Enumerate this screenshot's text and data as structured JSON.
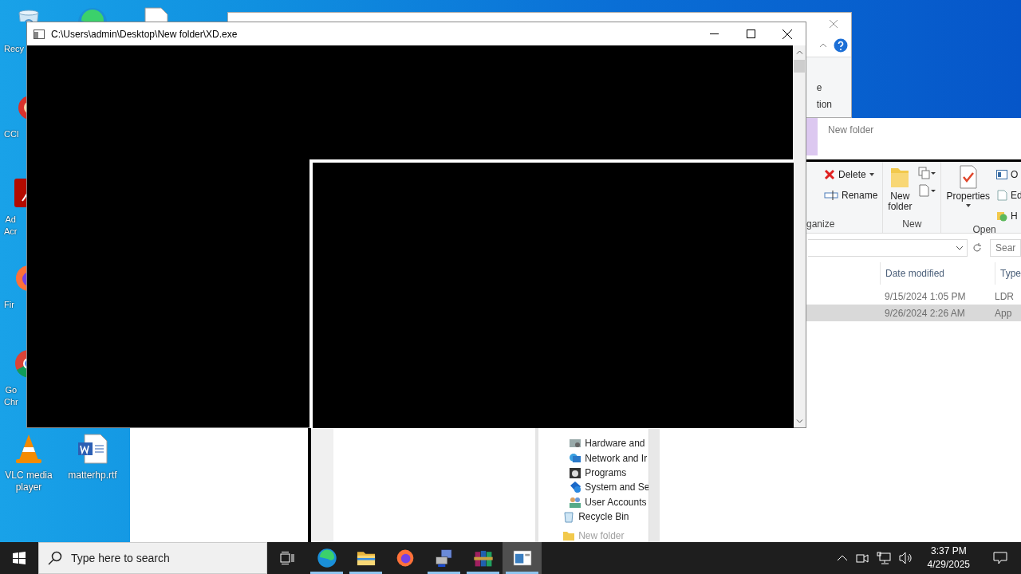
{
  "desktop": {
    "icons": [
      {
        "kind": "recycle",
        "label": "Recy"
      },
      {
        "kind": "ccleaner",
        "label": "CCl"
      },
      {
        "kind": "acrobat",
        "label": "Ad\nAcr"
      },
      {
        "kind": "firefox",
        "label": "Fir"
      },
      {
        "kind": "chrome",
        "label": "Go\nChr"
      },
      {
        "kind": "vlc",
        "label": "VLC media\nplayer"
      },
      {
        "kind": "edge"
      },
      {
        "kind": "document"
      },
      {
        "kind": "word",
        "label": "matterhp.rtf"
      }
    ]
  },
  "back_window": {
    "ribbon_label": "e\ntion"
  },
  "explorer": {
    "title": "New folder",
    "ribbon": {
      "groups": [
        {
          "label": "ganize",
          "items": [
            {
              "kind": "delete",
              "label": "Delete"
            },
            {
              "kind": "rename",
              "label": "Rename"
            }
          ]
        },
        {
          "label": "New",
          "items": [
            {
              "kind": "new-folder",
              "label": "New\nfolder"
            }
          ]
        },
        {
          "label": "Open",
          "items": [
            {
              "kind": "properties",
              "label": "Properties"
            },
            {
              "kind": "open",
              "label": "O"
            },
            {
              "kind": "edit",
              "label": "Ed"
            },
            {
              "kind": "history",
              "label": "H"
            }
          ]
        }
      ]
    },
    "search": {
      "placeholder": "Sear"
    },
    "columns": [
      "Date modified",
      "Type"
    ],
    "rows": [
      {
        "cells": [
          "9/15/2024 1:05 PM",
          "LDR"
        ],
        "selected": false
      },
      {
        "cells": [
          "9/26/2024 2:26 AM",
          "App"
        ],
        "selected": true
      }
    ],
    "nav_tree": {
      "control_panel_children": [
        {
          "kind": "hardware",
          "label": "Hardware and"
        },
        {
          "kind": "network",
          "label": "Network and Ir"
        },
        {
          "kind": "programs",
          "label": "Programs"
        },
        {
          "kind": "system",
          "label": "System and Se"
        },
        {
          "kind": "users",
          "label": "User Accounts"
        }
      ],
      "items": [
        {
          "kind": "recycle",
          "label": "Recycle Bin"
        },
        {
          "kind": "folder",
          "label": "New folder"
        }
      ]
    }
  },
  "console": {
    "title": "C:\\Users\\admin\\Desktop\\New folder\\XD.exe"
  },
  "taskbar": {
    "search": {
      "placeholder": "Type here to search"
    },
    "apps": [
      {
        "kind": "edge",
        "running": true,
        "active": false
      },
      {
        "kind": "explorer",
        "running": true,
        "active": false
      },
      {
        "kind": "firefox",
        "running": false,
        "active": false
      },
      {
        "kind": "network-app",
        "running": true,
        "active": false
      },
      {
        "kind": "archive",
        "running": true,
        "active": false
      },
      {
        "kind": "console",
        "running": true,
        "active": true
      }
    ],
    "time": "3:37 PM",
    "date": "4/29/2025"
  }
}
